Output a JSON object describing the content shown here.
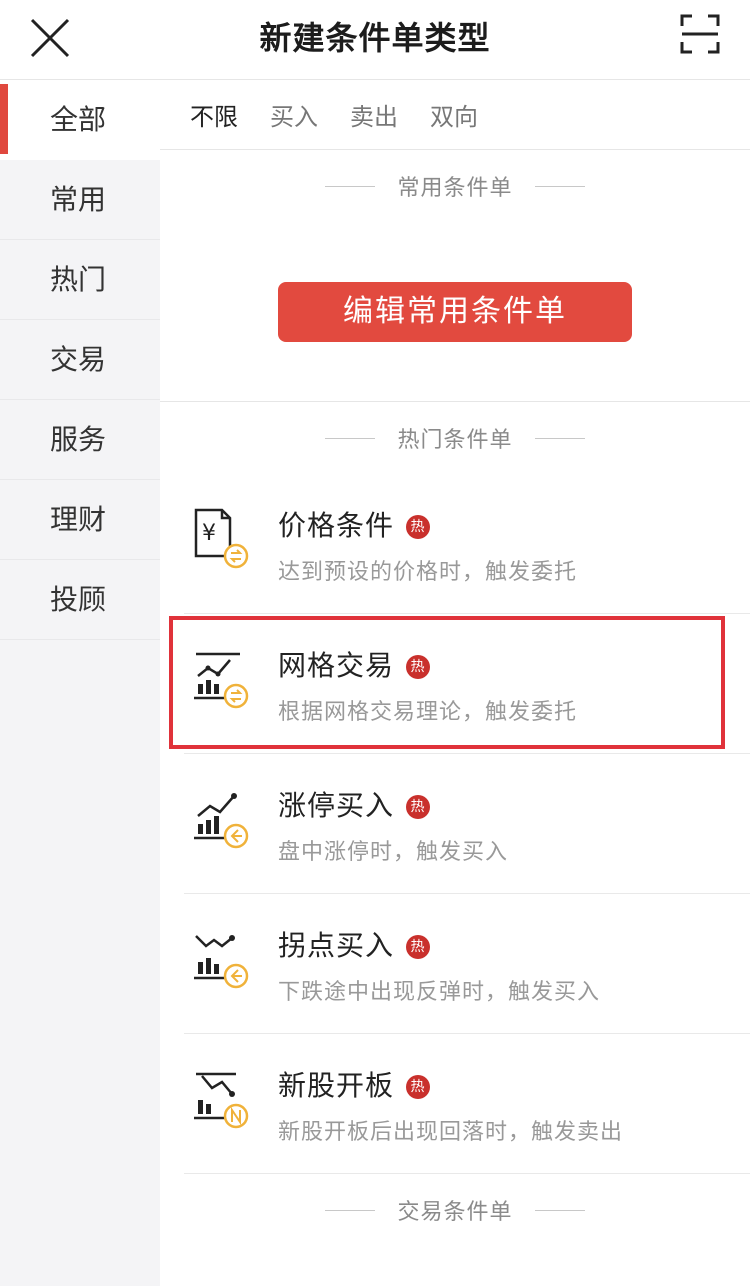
{
  "header": {
    "title": "新建条件单类型"
  },
  "sidebar": {
    "items": [
      {
        "label": "全部"
      },
      {
        "label": "常用"
      },
      {
        "label": "热门"
      },
      {
        "label": "交易"
      },
      {
        "label": "服务"
      },
      {
        "label": "理财"
      },
      {
        "label": "投顾"
      }
    ]
  },
  "filters": [
    {
      "label": "不限"
    },
    {
      "label": "买入"
    },
    {
      "label": "卖出"
    },
    {
      "label": "双向"
    }
  ],
  "sections": {
    "common": {
      "title": "常用条件单",
      "button": "编辑常用条件单"
    },
    "hot": {
      "title": "热门条件单"
    },
    "trade": {
      "title": "交易条件单"
    }
  },
  "hot_badge": "热",
  "items": [
    {
      "name": "价格条件",
      "desc": "达到预设的价格时，触发委托",
      "icon": "price-condition-icon"
    },
    {
      "name": "网格交易",
      "desc": "根据网格交易理论，触发委托",
      "icon": "grid-trading-icon"
    },
    {
      "name": "涨停买入",
      "desc": "盘中涨停时，触发买入",
      "icon": "limit-up-buy-icon"
    },
    {
      "name": "拐点买入",
      "desc": "下跌途中出现反弹时，触发买入",
      "icon": "turning-point-buy-icon"
    },
    {
      "name": "新股开板",
      "desc": "新股开板后出现回落时，触发卖出",
      "icon": "new-stock-open-icon"
    }
  ],
  "colors": {
    "accent": "#e24a3f",
    "badge": "#c9302c",
    "coin": "#f0b23a",
    "highlight": "#e0323a"
  }
}
